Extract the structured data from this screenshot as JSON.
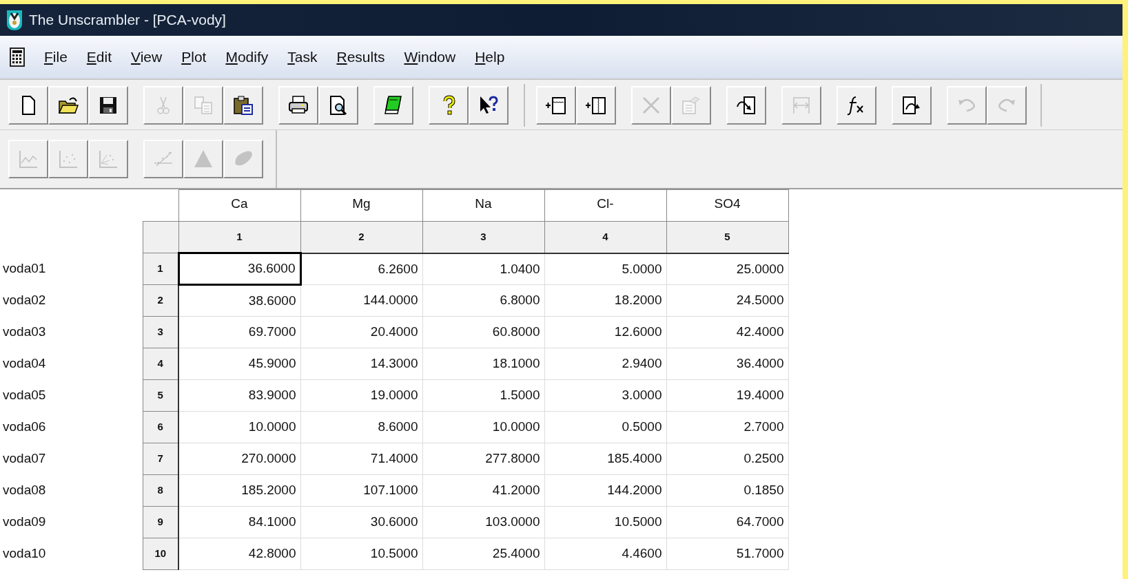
{
  "window": {
    "title": "The Unscrambler - [PCA-vody]"
  },
  "menu": [
    {
      "label": "File"
    },
    {
      "label": "Edit"
    },
    {
      "label": "View"
    },
    {
      "label": "Plot"
    },
    {
      "label": "Modify"
    },
    {
      "label": "Task"
    },
    {
      "label": "Results"
    },
    {
      "label": "Window"
    },
    {
      "label": "Help"
    }
  ],
  "toolbars": [
    {
      "groups": [
        [
          {
            "disabled": false
          },
          {
            "disabled": false
          },
          {
            "disabled": false
          }
        ],
        [
          {
            "disabled": true
          },
          {
            "disabled": true
          },
          {
            "disabled": false
          }
        ],
        [
          {
            "disabled": false
          },
          {
            "disabled": false
          }
        ],
        [
          {
            "disabled": false
          }
        ],
        [
          {
            "disabled": false
          },
          {
            "disabled": false
          }
        ]
      ]
    },
    {
      "groups": [
        [
          {
            "disabled": false
          },
          {
            "disabled": false
          }
        ],
        [
          {
            "disabled": true
          },
          {
            "disabled": true
          }
        ],
        [
          {
            "disabled": false
          }
        ],
        [
          {
            "disabled": true
          }
        ],
        [
          {
            "disabled": false
          }
        ],
        [
          {
            "disabled": false
          }
        ],
        [
          {
            "disabled": true
          },
          {
            "disabled": true
          }
        ]
      ]
    },
    {
      "groups": [
        [
          {
            "disabled": true
          },
          {
            "disabled": true
          },
          {
            "disabled": true
          }
        ],
        [
          {
            "disabled": true
          },
          {
            "disabled": true
          },
          {
            "disabled": true
          }
        ]
      ]
    }
  ],
  "table": {
    "columns": [
      {
        "label": "Ca",
        "number": "1"
      },
      {
        "label": "Mg",
        "number": "2"
      },
      {
        "label": "Na",
        "number": "3"
      },
      {
        "label": "Cl-",
        "number": "4"
      },
      {
        "label": "SO4",
        "number": "5"
      }
    ],
    "rows": [
      {
        "name": "voda01",
        "number": "1",
        "cells": [
          {
            "text": "36.6000",
            "selected": true
          },
          {
            "text": "6.2600",
            "selected": false
          },
          {
            "text": "1.0400",
            "selected": false
          },
          {
            "text": "5.0000",
            "selected": false
          },
          {
            "text": "25.0000",
            "selected": false
          }
        ]
      },
      {
        "name": "voda02",
        "number": "2",
        "cells": [
          {
            "text": "38.6000",
            "selected": false
          },
          {
            "text": "144.0000",
            "selected": false
          },
          {
            "text": "6.8000",
            "selected": false
          },
          {
            "text": "18.2000",
            "selected": false
          },
          {
            "text": "24.5000",
            "selected": false
          }
        ]
      },
      {
        "name": "voda03",
        "number": "3",
        "cells": [
          {
            "text": "69.7000",
            "selected": false
          },
          {
            "text": "20.4000",
            "selected": false
          },
          {
            "text": "60.8000",
            "selected": false
          },
          {
            "text": "12.6000",
            "selected": false
          },
          {
            "text": "42.4000",
            "selected": false
          }
        ]
      },
      {
        "name": "voda04",
        "number": "4",
        "cells": [
          {
            "text": "45.9000",
            "selected": false
          },
          {
            "text": "14.3000",
            "selected": false
          },
          {
            "text": "18.1000",
            "selected": false
          },
          {
            "text": "2.9400",
            "selected": false
          },
          {
            "text": "36.4000",
            "selected": false
          }
        ]
      },
      {
        "name": "voda05",
        "number": "5",
        "cells": [
          {
            "text": "83.9000",
            "selected": false
          },
          {
            "text": "19.0000",
            "selected": false
          },
          {
            "text": "1.5000",
            "selected": false
          },
          {
            "text": "3.0000",
            "selected": false
          },
          {
            "text": "19.4000",
            "selected": false
          }
        ]
      },
      {
        "name": "voda06",
        "number": "6",
        "cells": [
          {
            "text": "10.0000",
            "selected": false
          },
          {
            "text": "8.6000",
            "selected": false
          },
          {
            "text": "10.0000",
            "selected": false
          },
          {
            "text": "0.5000",
            "selected": false
          },
          {
            "text": "2.7000",
            "selected": false
          }
        ]
      },
      {
        "name": "voda07",
        "number": "7",
        "cells": [
          {
            "text": "270.0000",
            "selected": false
          },
          {
            "text": "71.4000",
            "selected": false
          },
          {
            "text": "277.8000",
            "selected": false
          },
          {
            "text": "185.4000",
            "selected": false
          },
          {
            "text": "0.2500",
            "selected": false
          }
        ]
      },
      {
        "name": "voda08",
        "number": "8",
        "cells": [
          {
            "text": "185.2000",
            "selected": false
          },
          {
            "text": "107.1000",
            "selected": false
          },
          {
            "text": "41.2000",
            "selected": false
          },
          {
            "text": "144.2000",
            "selected": false
          },
          {
            "text": "0.1850",
            "selected": false
          }
        ]
      },
      {
        "name": "voda09",
        "number": "9",
        "cells": [
          {
            "text": "84.1000",
            "selected": false
          },
          {
            "text": "30.6000",
            "selected": false
          },
          {
            "text": "103.0000",
            "selected": false
          },
          {
            "text": "10.5000",
            "selected": false
          },
          {
            "text": "64.7000",
            "selected": false
          }
        ]
      },
      {
        "name": "voda10",
        "number": "10",
        "cells": [
          {
            "text": "42.8000",
            "selected": false
          },
          {
            "text": "10.5000",
            "selected": false
          },
          {
            "text": "25.4000",
            "selected": false
          },
          {
            "text": "4.4600",
            "selected": false
          },
          {
            "text": "51.7000",
            "selected": false
          }
        ]
      }
    ]
  }
}
